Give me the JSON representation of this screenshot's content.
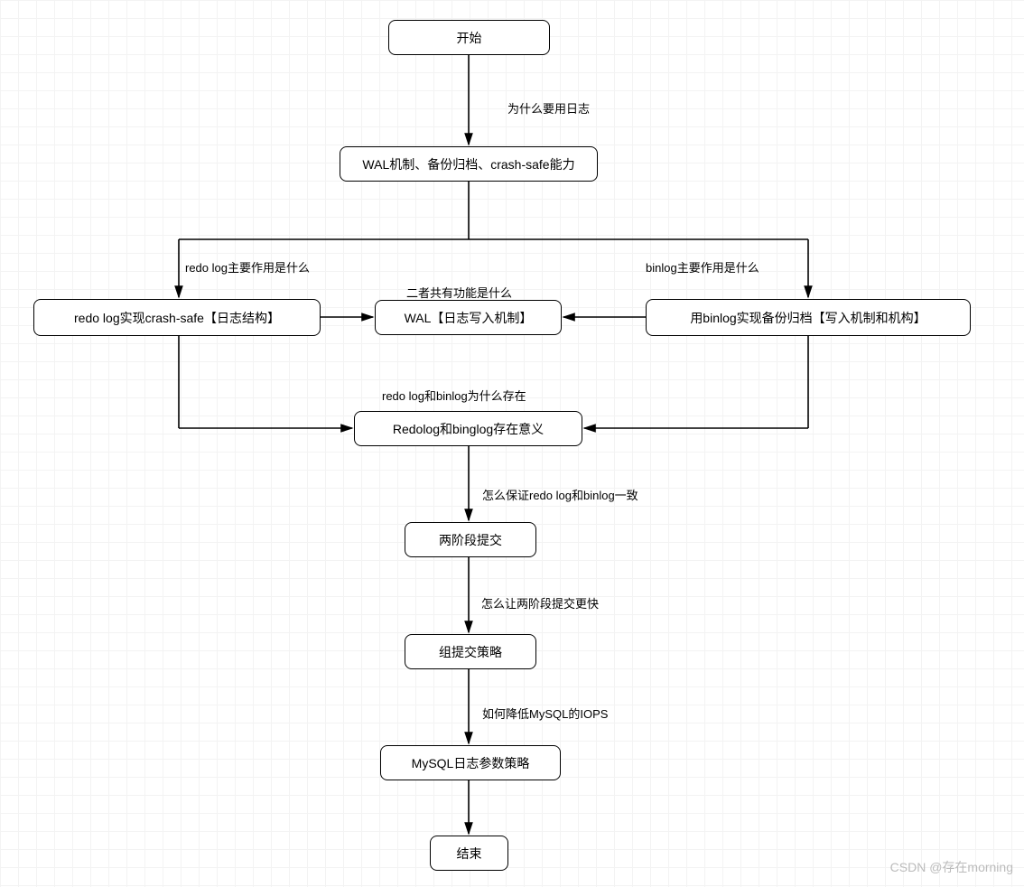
{
  "nodes": {
    "start": "开始",
    "wal_backup": "WAL机制、备份归档、crash-safe能力",
    "redo_crash": "redo log实现crash-safe【日志结构】",
    "wal_write": "WAL【日志写入机制】",
    "binlog_backup": "用binlog实现备份归档【写入机制和机构】",
    "exist_meaning": "Redolog和binglog存在意义",
    "two_phase": "两阶段提交",
    "group_commit": "组提交策略",
    "mysql_params": "MySQL日志参数策略",
    "end": "结束"
  },
  "labels": {
    "why_log": "为什么要用日志",
    "redo_role": "redo log主要作用是什么",
    "binlog_role": "binlog主要作用是什么",
    "common_func": "二者共有功能是什么",
    "why_exist": "redo log和binlog为什么存在",
    "consistency": "怎么保证redo log和binlog一致",
    "faster_2pc": "怎么让两阶段提交更快",
    "lower_iops": "如何降低MySQL的IOPS"
  },
  "watermark": "CSDN @存在morning"
}
